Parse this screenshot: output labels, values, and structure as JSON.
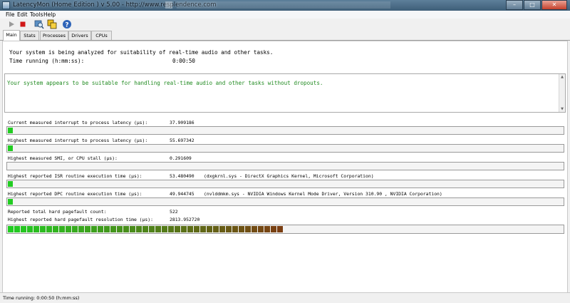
{
  "window": {
    "title": "LatencyMon  (Home Edition )  v 5.00 - http://www.resplendence.com",
    "controls": {
      "minimize": "–",
      "maximize": "□",
      "close": "✕"
    }
  },
  "menu": [
    "File",
    "Edit",
    "Tools",
    "Help"
  ],
  "toolbar": {
    "icons": [
      "play-icon",
      "stop-icon",
      "analyze-icon",
      "windows-icon",
      "help-icon"
    ]
  },
  "tabs": [
    "Main",
    "Stats",
    "Processes",
    "Drivers",
    "CPUs"
  ],
  "main": {
    "analyzing_text": "Your system is being analyzed for suitability of real-time audio and other tasks.",
    "time_running_label": "Time running (h:mm:ss):",
    "time_running_value": "0:00:50",
    "conclusion": "Your system appears to be suitable for handling real-time audio and other tasks without dropouts.",
    "conclusion_color": "#228b22",
    "metrics": [
      {
        "label": "Current measured interrupt to process latency (µs):",
        "value": "37.909186",
        "extra": "",
        "bar_fraction": 0.009
      },
      {
        "label": "Highest measured interrupt to process latency (µs):",
        "value": "55.697342",
        "extra": "",
        "bar_fraction": 0.009
      },
      {
        "label": "Highest measured SMI, or CPU stall (µs):",
        "value": "0.291609",
        "extra": "",
        "bar_fraction": 0.0
      },
      {
        "label": "Highest reported ISR routine execution time (µs):",
        "value": "53.480490",
        "extra": "(dxgkrnl.sys - DirectX Graphics Kernel, Microsoft Corporation)",
        "bar_fraction": 0.009
      },
      {
        "label": "Highest reported DPC routine execution time (µs):",
        "value": "49.944745",
        "extra": "(nvlddmkm.sys - NVIDIA Windows Kernel Mode Driver, Version 310.90 , NVIDIA Corporation)",
        "bar_fraction": 0.009
      }
    ],
    "pagefault_count_label": "Reported total hard pagefault count:",
    "pagefault_count_value": "522",
    "pagefault_res_label": "Highest reported hard pagefault resolution time (µs):",
    "pagefault_res_value": "2813.952720",
    "pagefault_bar_fraction": 0.505,
    "bar_colors": {
      "low": "#22cc22",
      "high": "#7a3e12"
    }
  },
  "status": {
    "text": "Time running: 0:00:50  (h:mm:ss)"
  }
}
